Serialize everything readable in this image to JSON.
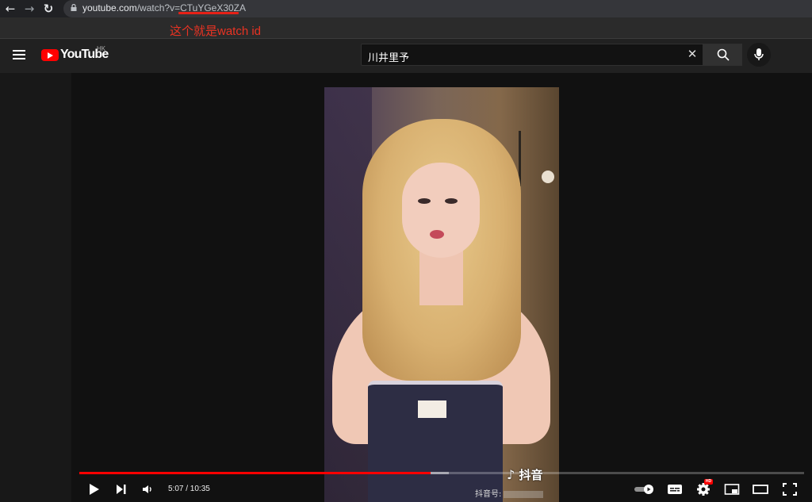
{
  "browser": {
    "url_host": "youtube.com",
    "url_path": "/watch?v=",
    "url_watch_id": "CTuYGeX30ZA",
    "back_glyph": "←",
    "forward_glyph": "→",
    "reload_glyph": "↻"
  },
  "annotation": {
    "text": "这个就是watch id",
    "color": "#ea3323"
  },
  "header": {
    "logo_text": "YouTube",
    "country_code": "HK",
    "search_value": "川井里予",
    "clear_glyph": "✕"
  },
  "video": {
    "watermark": "抖音",
    "watermark_id_label": "抖音号:",
    "played_fraction": 0.485,
    "loaded_fraction": 0.51
  },
  "controls": {
    "time_display": "5:07 / 10:35",
    "hd_badge": "HD"
  },
  "colors": {
    "accent_red": "#ff0000",
    "background": "#181818",
    "header": "#212121"
  }
}
